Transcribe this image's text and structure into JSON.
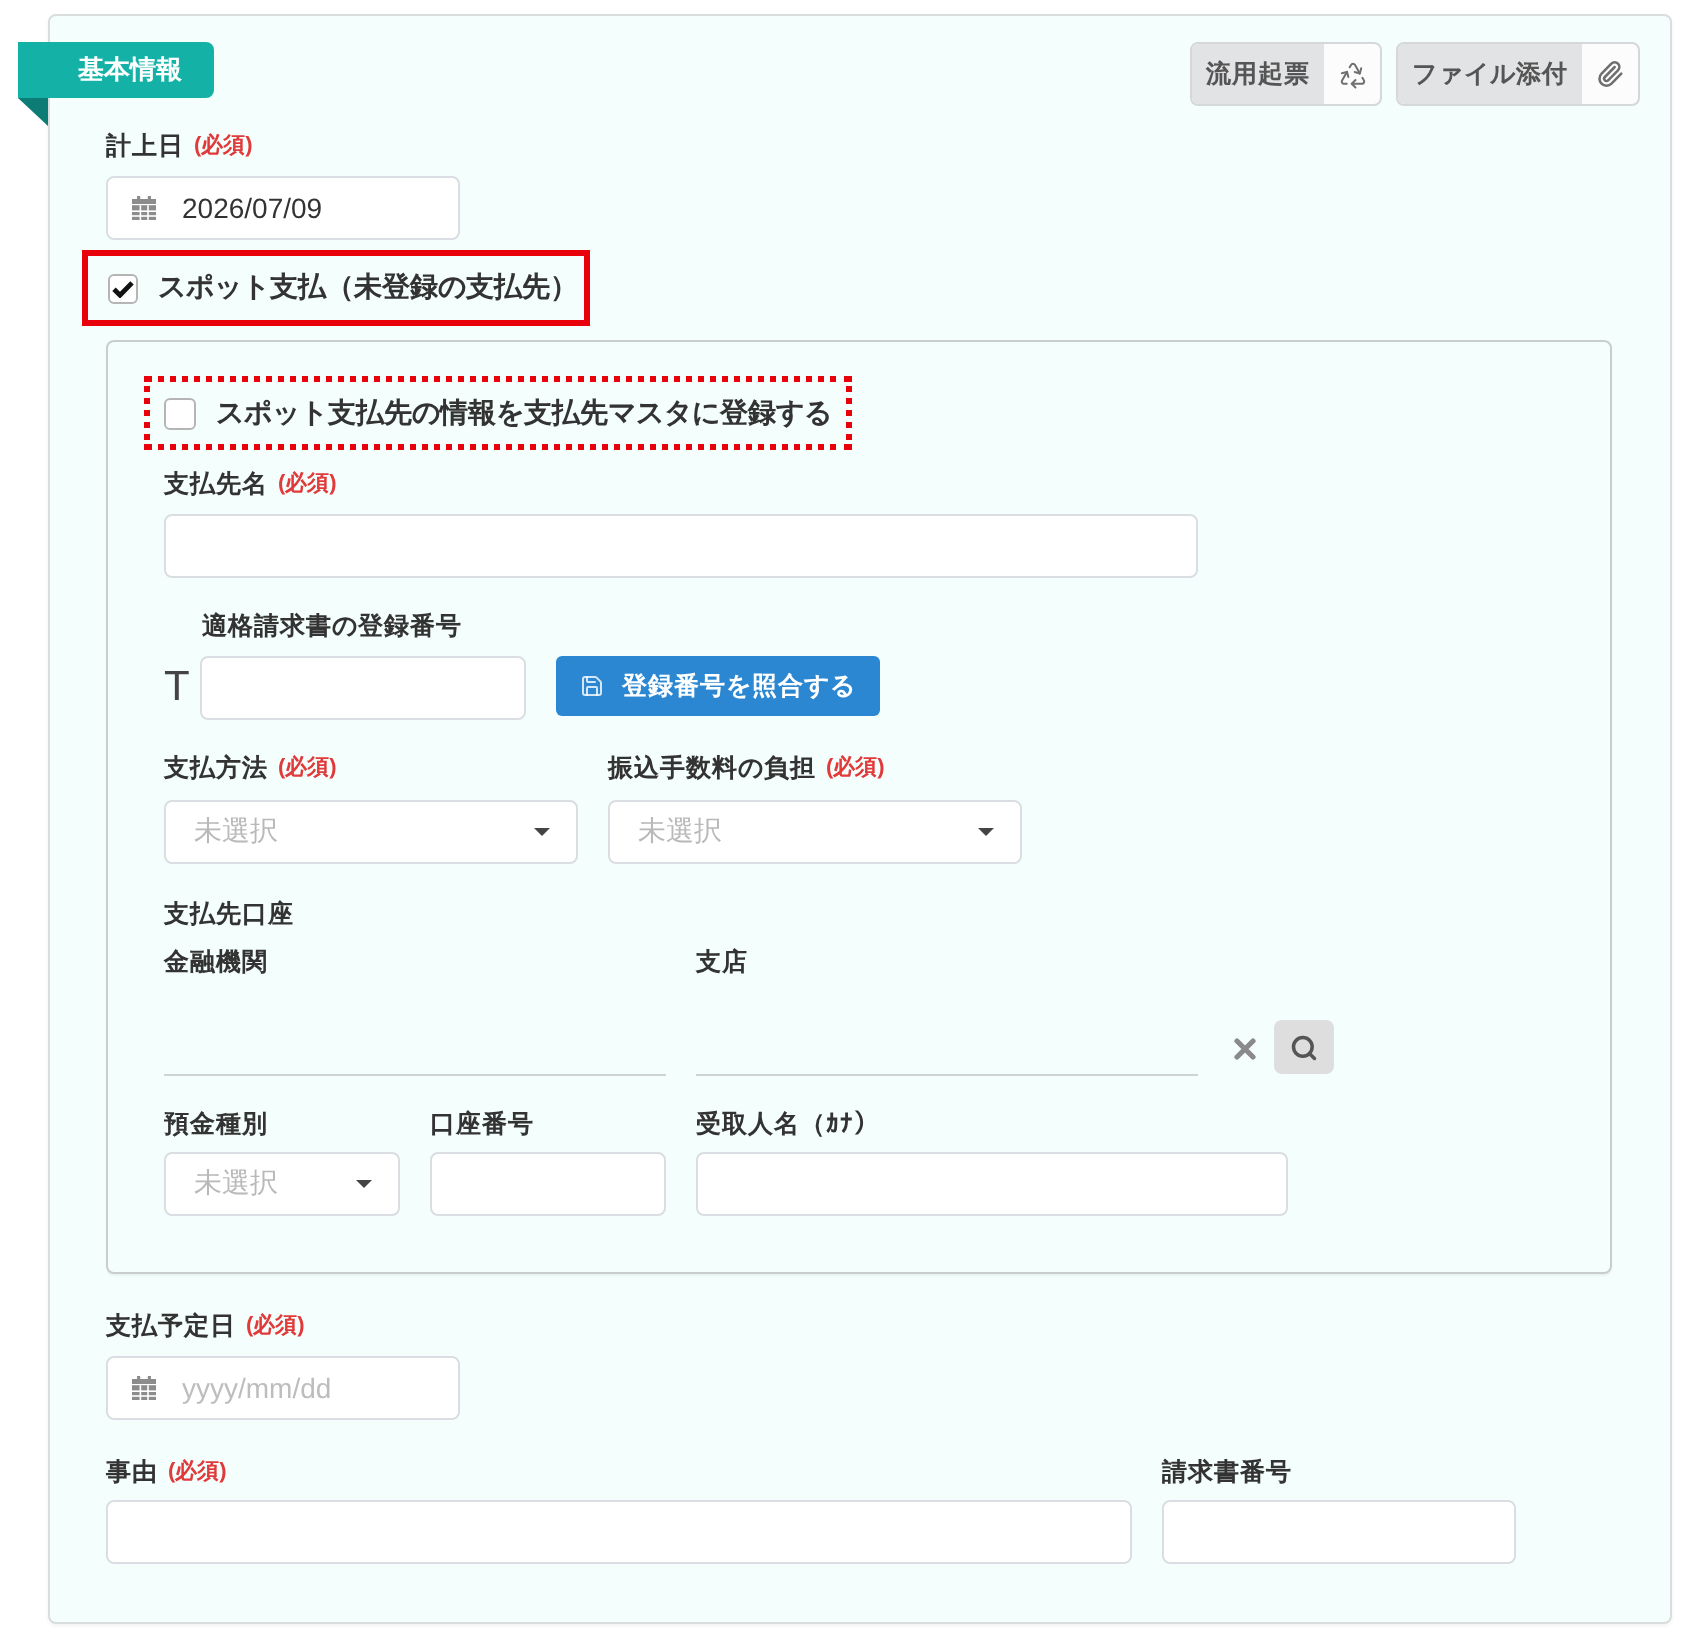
{
  "section": {
    "title": "基本情報"
  },
  "actions": [
    {
      "kind": "reuse",
      "label": "流用起票"
    },
    {
      "kind": "attach",
      "label": "ファイル添付"
    }
  ],
  "recorded_date": {
    "label": "計上日",
    "required": "(必須)",
    "value": "2026/07/09"
  },
  "spot_payment": {
    "label": "スポット支払（未登録の支払先）",
    "checked": true,
    "highlighted": true,
    "kind": "solid"
  },
  "spot_panel": {
    "register_master": {
      "label": "スポット支払先の情報を支払先マスタに登録する",
      "checked": false,
      "highlighted": true,
      "kind": "dotted"
    },
    "payee_name": {
      "label": "支払先名",
      "required": "(必須)"
    },
    "registration_number": {
      "label": "適格請求書の登録番号",
      "prefix": "T"
    },
    "verify_button": {
      "label": "登録番号を照合する"
    },
    "payment_method": {
      "label": "支払方法",
      "required": "(必須)",
      "placeholder": "未選択"
    },
    "fee_burden": {
      "label": "振込手数料の負担",
      "required": "(必須)",
      "placeholder": "未選択"
    },
    "account": {
      "title": "支払先口座",
      "bank": {
        "label": "金融機関"
      },
      "branch": {
        "label": "支店"
      },
      "deposit_type": {
        "label": "預金種別",
        "placeholder": "未選択"
      },
      "account_number": {
        "label": "口座番号"
      },
      "recipient": {
        "label": "受取人名（ｶﾅ）"
      }
    }
  },
  "scheduled_date": {
    "label": "支払予定日",
    "required": "(必須)",
    "placeholder": "yyyy/mm/dd"
  },
  "reason": {
    "label": "事由",
    "required": "(必須)"
  },
  "invoice_number": {
    "label": "請求書番号"
  }
}
